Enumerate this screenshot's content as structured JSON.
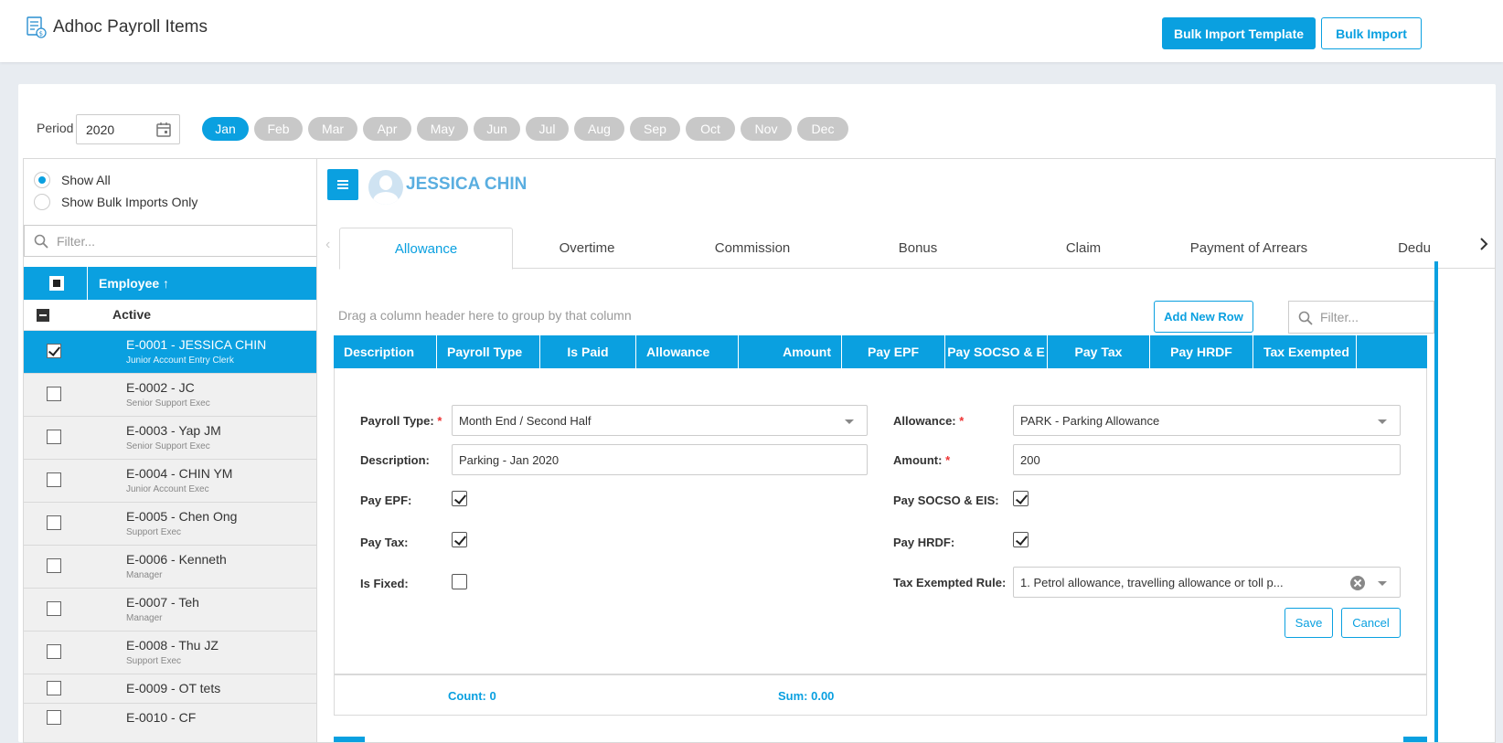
{
  "header": {
    "title": "Adhoc Payroll Items",
    "bulk_import_template": "Bulk Import Template",
    "bulk_import": "Bulk Import"
  },
  "period": {
    "label": "Period",
    "year": "2020",
    "months": [
      "Jan",
      "Feb",
      "Mar",
      "Apr",
      "May",
      "Jun",
      "Jul",
      "Aug",
      "Sep",
      "Oct",
      "Nov",
      "Dec"
    ],
    "active_month": "Jan"
  },
  "sidebar": {
    "show_all": "Show All",
    "show_bulk_only": "Show Bulk Imports Only",
    "filter_placeholder": "Filter...",
    "column_header": "Employee ↑",
    "group_label": "Active",
    "employees": [
      {
        "name": "E-0001 - JESSICA CHIN",
        "role": "Junior Account Entry Clerk"
      },
      {
        "name": "E-0002 - JC",
        "role": "Senior Support Exec"
      },
      {
        "name": "E-0003 - Yap JM",
        "role": "Senior Support Exec"
      },
      {
        "name": "E-0004 - CHIN YM",
        "role": "Junior Account Exec"
      },
      {
        "name": "E-0005 - Chen Ong",
        "role": "Support Exec"
      },
      {
        "name": "E-0006 - Kenneth",
        "role": "Manager"
      },
      {
        "name": "E-0007 - Teh",
        "role": "Manager"
      },
      {
        "name": "E-0008 - Thu JZ",
        "role": "Support Exec"
      },
      {
        "name": "E-0009 - OT tets",
        "role": ""
      },
      {
        "name": "E-0010 - CF",
        "role": ""
      }
    ]
  },
  "main": {
    "employee_name": "JESSICA CHIN",
    "tabs": [
      "Allowance",
      "Overtime",
      "Commission",
      "Bonus",
      "Claim",
      "Payment of Arrears",
      "Dedu"
    ],
    "active_tab": "Allowance",
    "group_hint": "Drag a column header here to group by that column",
    "add_new_row": "Add New Row",
    "filter_placeholder": "Filter...",
    "columns": [
      "Description",
      "Payroll Type",
      "Is Paid",
      "Allowance",
      "Amount",
      "Pay EPF",
      "Pay SOCSO & E",
      "Pay Tax",
      "Pay HRDF",
      "Tax Exempted"
    ],
    "form": {
      "payroll_type_label": "Payroll Type:",
      "payroll_type_value": "Month End / Second Half",
      "description_label": "Description:",
      "description_value": "Parking - Jan 2020",
      "pay_epf_label": "Pay EPF:",
      "pay_tax_label": "Pay Tax:",
      "is_fixed_label": "Is Fixed:",
      "allowance_label": "Allowance:",
      "allowance_value": "PARK - Parking Allowance",
      "amount_label": "Amount:",
      "amount_value": "200",
      "pay_socso_label": "Pay SOCSO & EIS:",
      "pay_hrdf_label": "Pay HRDF:",
      "tax_exempted_label": "Tax Exempted Rule:",
      "tax_exempted_value": "1. Petrol allowance, travelling allowance or toll p...",
      "required_mark": "*",
      "save": "Save",
      "cancel": "Cancel"
    },
    "footer": {
      "count": "Count: 0",
      "sum": "Sum: 0.00"
    }
  },
  "colors": {
    "accent": "#0aa0e0",
    "month_inactive": "#c8c8c8"
  }
}
